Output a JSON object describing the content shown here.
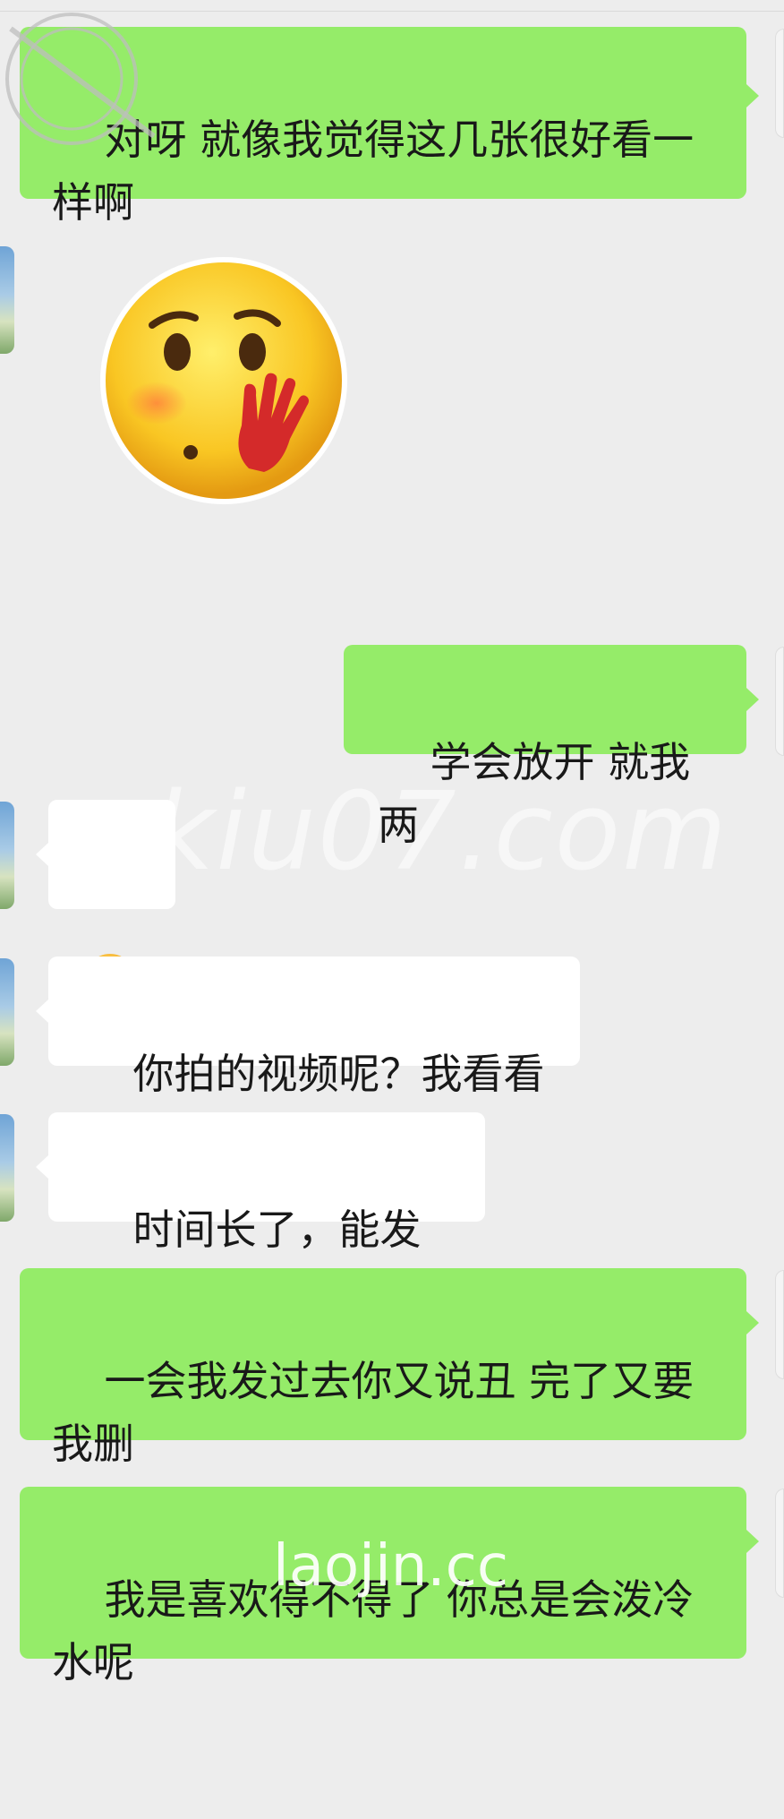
{
  "messages": [
    {
      "side": "right",
      "type": "text",
      "text": "对呀 就像我觉得这几张很好看一样啊"
    },
    {
      "side": "left",
      "type": "sticker",
      "icon": "shy-face-hand-icon"
    },
    {
      "side": "right",
      "type": "text",
      "text": "学会放开 就我两"
    },
    {
      "side": "left",
      "type": "emoji",
      "icon": "pensive-face-icon"
    },
    {
      "side": "left",
      "type": "text",
      "text": "你拍的视频呢？我看看"
    },
    {
      "side": "left",
      "type": "text",
      "text": "时间长了，能发吗"
    },
    {
      "side": "right",
      "type": "text",
      "text": "一会我发过去你又说丑 完了又要我删"
    },
    {
      "side": "right",
      "type": "text",
      "text": "我是喜欢得不得了 你总是会泼冷水呢"
    }
  ],
  "watermarks": {
    "center": "kiu07.com",
    "bottom": "laojin.cc"
  },
  "colors": {
    "background": "#ededed",
    "green_bubble": "#95ec69",
    "white_bubble": "#ffffff",
    "text": "#191919"
  }
}
